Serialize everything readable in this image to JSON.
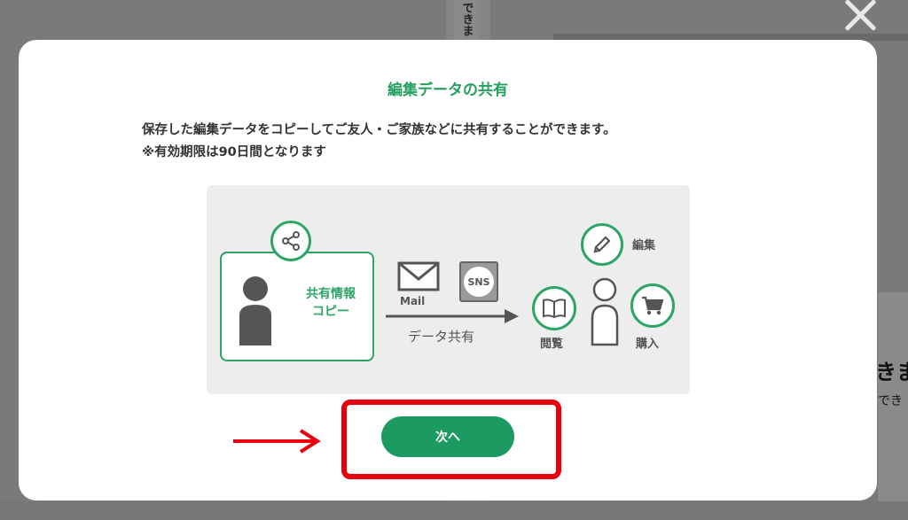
{
  "background": {
    "strip_text": "できま",
    "right_text_1": "きま",
    "right_text_2": "でき"
  },
  "modal": {
    "title": "編集データの共有",
    "description_line1": "保存した編集データをコピーしてご友人・ご家族などに共有することができます。",
    "description_line2": "※有効期限は90日間となります",
    "illustration": {
      "info_label_line1": "共有情報",
      "info_label_line2": "コピー",
      "mail_label": "Mail",
      "sns_label": "SNS",
      "share_label": "データ共有",
      "edit_label": "編集",
      "view_label": "閲覧",
      "buy_label": "購入"
    },
    "next_button": "次へ"
  },
  "colors": {
    "accent": "#2ea466",
    "button": "#1d9a62",
    "highlight": "#e8000f"
  }
}
